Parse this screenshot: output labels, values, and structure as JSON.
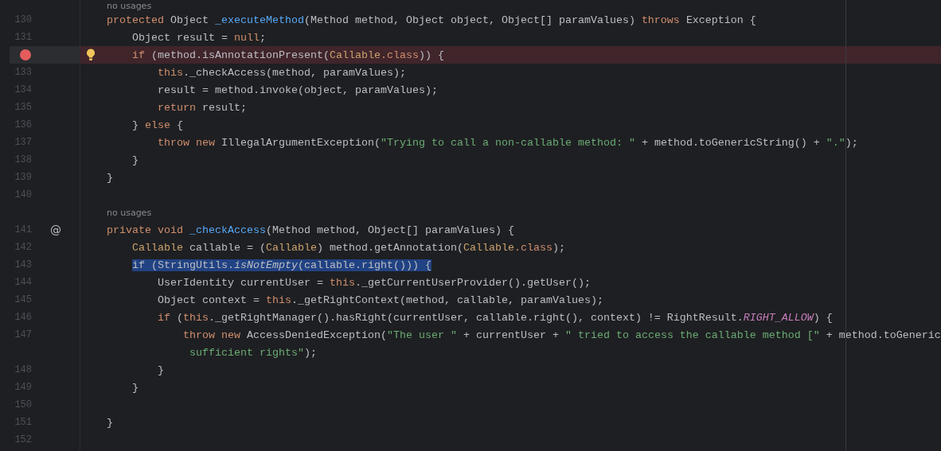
{
  "editor": {
    "lines": [
      {
        "kind": "hint",
        "text": "no usages"
      },
      {
        "kind": "code",
        "number": "130",
        "tokens": [
          {
            "text": "protected ",
            "kind": "kw"
          },
          {
            "text": "Object ",
            "kind": "plain"
          },
          {
            "text": "_executeMethod",
            "kind": "decl"
          },
          {
            "text": "(Method method, Object object, Object[] paramValues) ",
            "kind": "plain"
          },
          {
            "text": "throws ",
            "kind": "kw"
          },
          {
            "text": "Exception {",
            "kind": "plain"
          }
        ]
      },
      {
        "kind": "code",
        "number": "131",
        "tokens": [
          {
            "text": "    Object result = ",
            "kind": "plain"
          },
          {
            "text": "null",
            "kind": "kw"
          },
          {
            "text": ";",
            "kind": "plain"
          }
        ]
      },
      {
        "kind": "code",
        "breakpoint": true,
        "intention_bulb": true,
        "tokens": [
          {
            "text": "    if ",
            "kind": "kw"
          },
          {
            "text": "(method.isAnnotationPresent(",
            "kind": "plain"
          },
          {
            "text": "Callable",
            "kind": "type"
          },
          {
            "text": ".class",
            "kind": "kw"
          },
          {
            "text": ")) {",
            "kind": "plain"
          }
        ]
      },
      {
        "kind": "code",
        "number": "133",
        "tokens": [
          {
            "text": "        this",
            "kind": "kw"
          },
          {
            "text": "._checkAccess(method, paramValues);",
            "kind": "plain"
          }
        ]
      },
      {
        "kind": "code",
        "number": "134",
        "tokens": [
          {
            "text": "        result = method.invoke(object, paramValues);",
            "kind": "plain"
          }
        ]
      },
      {
        "kind": "code",
        "number": "135",
        "tokens": [
          {
            "text": "        return ",
            "kind": "kw"
          },
          {
            "text": "result;",
            "kind": "plain"
          }
        ]
      },
      {
        "kind": "code",
        "number": "136",
        "tokens": [
          {
            "text": "    } ",
            "kind": "plain"
          },
          {
            "text": "else ",
            "kind": "kw"
          },
          {
            "text": "{",
            "kind": "plain"
          }
        ]
      },
      {
        "kind": "code",
        "number": "137",
        "tokens": [
          {
            "text": "        throw new ",
            "kind": "kw"
          },
          {
            "text": "IllegalArgumentException(",
            "kind": "plain"
          },
          {
            "text": "\"Trying to call a non-callable method: \"",
            "kind": "str"
          },
          {
            "text": " + method.toGenericString() + ",
            "kind": "plain"
          },
          {
            "text": "\".\"",
            "kind": "str"
          },
          {
            "text": ");",
            "kind": "plain"
          }
        ]
      },
      {
        "kind": "code",
        "number": "138",
        "tokens": [
          {
            "text": "    }",
            "kind": "plain"
          }
        ]
      },
      {
        "kind": "code",
        "number": "139",
        "tokens": [
          {
            "text": "}",
            "kind": "plain"
          }
        ]
      },
      {
        "kind": "code",
        "number": "140"
      },
      {
        "kind": "hint",
        "text": "no usages"
      },
      {
        "kind": "code",
        "number": "141",
        "gutter_text": "@",
        "tokens": [
          {
            "text": "private void ",
            "kind": "kw"
          },
          {
            "text": "_checkAccess",
            "kind": "decl"
          },
          {
            "text": "(Method method, Object[] paramValues) {",
            "kind": "plain"
          }
        ]
      },
      {
        "kind": "code",
        "number": "142",
        "tokens": [
          {
            "text": "    Callable ",
            "kind": "type"
          },
          {
            "text": "callable = (",
            "kind": "plain"
          },
          {
            "text": "Callable",
            "kind": "type"
          },
          {
            "text": ") method.getAnnotation(",
            "kind": "plain"
          },
          {
            "text": "Callable",
            "kind": "type"
          },
          {
            "text": ".class",
            "kind": "kw"
          },
          {
            "text": ");",
            "kind": "plain"
          }
        ]
      },
      {
        "kind": "code",
        "number": "143",
        "tokens": [
          {
            "text": "    if (StringUtils.",
            "kind": "plain",
            "selected": true
          },
          {
            "text": "isNotEmpty",
            "kind": "italic",
            "selected": true
          },
          {
            "text": "(callable.right())) {",
            "kind": "plain",
            "selected": true
          }
        ]
      },
      {
        "kind": "code",
        "number": "144",
        "tokens": [
          {
            "text": "        UserIdentity currentUser = ",
            "kind": "plain"
          },
          {
            "text": "this",
            "kind": "kw"
          },
          {
            "text": "._getCurrentUserProvider().getUser();",
            "kind": "plain"
          }
        ]
      },
      {
        "kind": "code",
        "number": "145",
        "tokens": [
          {
            "text": "        Object context = ",
            "kind": "plain"
          },
          {
            "text": "this",
            "kind": "kw"
          },
          {
            "text": "._getRightContext(method, callable, paramValues);",
            "kind": "plain"
          }
        ]
      },
      {
        "kind": "code",
        "number": "146",
        "tokens": [
          {
            "text": "        if ",
            "kind": "kw"
          },
          {
            "text": "(",
            "kind": "plain"
          },
          {
            "text": "this",
            "kind": "kw"
          },
          {
            "text": "._getRightManager().hasRight(currentUser, callable.right(), context) != RightResult.",
            "kind": "plain"
          },
          {
            "text": "RIGHT_ALLOW",
            "kind": "const"
          },
          {
            "text": ") {",
            "kind": "plain"
          }
        ]
      },
      {
        "kind": "code",
        "number": "147",
        "tokens": [
          {
            "text": "            throw new ",
            "kind": "kw"
          },
          {
            "text": "AccessDeniedException(",
            "kind": "plain"
          },
          {
            "text": "\"The user \"",
            "kind": "str"
          },
          {
            "text": " + currentUser + ",
            "kind": "plain"
          },
          {
            "text": "\" tried to access the callable method [\"",
            "kind": "str"
          },
          {
            "text": " + method.toGeneric",
            "kind": "plain"
          }
        ]
      },
      {
        "kind": "wrap",
        "tokens": [
          {
            "text": "             sufficient rights\"",
            "kind": "str"
          },
          {
            "text": ");",
            "kind": "plain"
          }
        ]
      },
      {
        "kind": "code",
        "number": "148",
        "tokens": [
          {
            "text": "        }",
            "kind": "plain"
          }
        ]
      },
      {
        "kind": "code",
        "number": "149",
        "tokens": [
          {
            "text": "    }",
            "kind": "plain"
          }
        ]
      },
      {
        "kind": "code",
        "number": "150"
      },
      {
        "kind": "code",
        "number": "151",
        "tokens": [
          {
            "text": "}",
            "kind": "plain"
          }
        ]
      },
      {
        "kind": "code",
        "number": "152"
      }
    ]
  }
}
